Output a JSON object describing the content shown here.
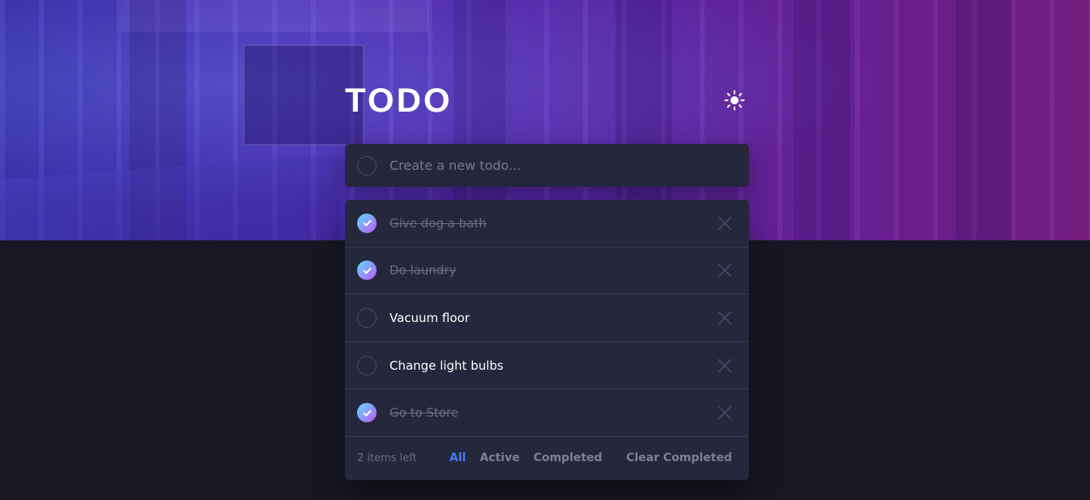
{
  "header": {
    "title": "TODO"
  },
  "new_todo": {
    "placeholder": "Create a new todo..."
  },
  "todos": [
    {
      "text": "Give dog a bath",
      "completed": true
    },
    {
      "text": "Do laundry",
      "completed": true
    },
    {
      "text": "Vacuum floor",
      "completed": false
    },
    {
      "text": "Change light bulbs",
      "completed": false
    },
    {
      "text": "Go to Store",
      "completed": true
    }
  ],
  "footer": {
    "items_left": "2 items left",
    "filters": {
      "all": "All",
      "active": "Active",
      "completed": "Completed"
    },
    "clear": "Clear Completed"
  },
  "colors": {
    "accent": "#3a7cfd",
    "check_gradient_start": "#57ddff",
    "check_gradient_end": "#c058f3"
  },
  "icons": {
    "theme": "sun-icon",
    "check": "check-icon",
    "delete": "close-icon"
  }
}
